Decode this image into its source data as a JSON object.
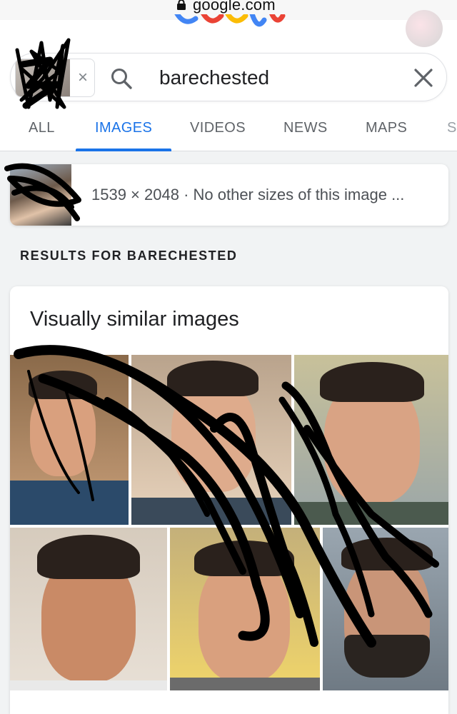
{
  "browser": {
    "domain": "google.com"
  },
  "search": {
    "query": "barechested",
    "chip_close": "×"
  },
  "tabs": [
    {
      "label": "ALL",
      "active": false
    },
    {
      "label": "IMAGES",
      "active": true
    },
    {
      "label": "VIDEOS",
      "active": false
    },
    {
      "label": "NEWS",
      "active": false
    },
    {
      "label": "MAPS",
      "active": false
    },
    {
      "label": "S",
      "active": false
    }
  ],
  "query_image": {
    "meta": "1539 × 2048 · No other sizes of this image ..."
  },
  "results_heading": "RESULTS FOR BARECHESTED",
  "similar": {
    "title": "Visually similar images",
    "images": [
      {
        "name": "similar-image-1"
      },
      {
        "name": "similar-image-2"
      },
      {
        "name": "similar-image-3"
      },
      {
        "name": "similar-image-4"
      },
      {
        "name": "similar-image-5"
      },
      {
        "name": "similar-image-6"
      }
    ]
  },
  "colors": {
    "accent": "#1a73e8",
    "text": "#202124",
    "muted": "#5f6368"
  }
}
